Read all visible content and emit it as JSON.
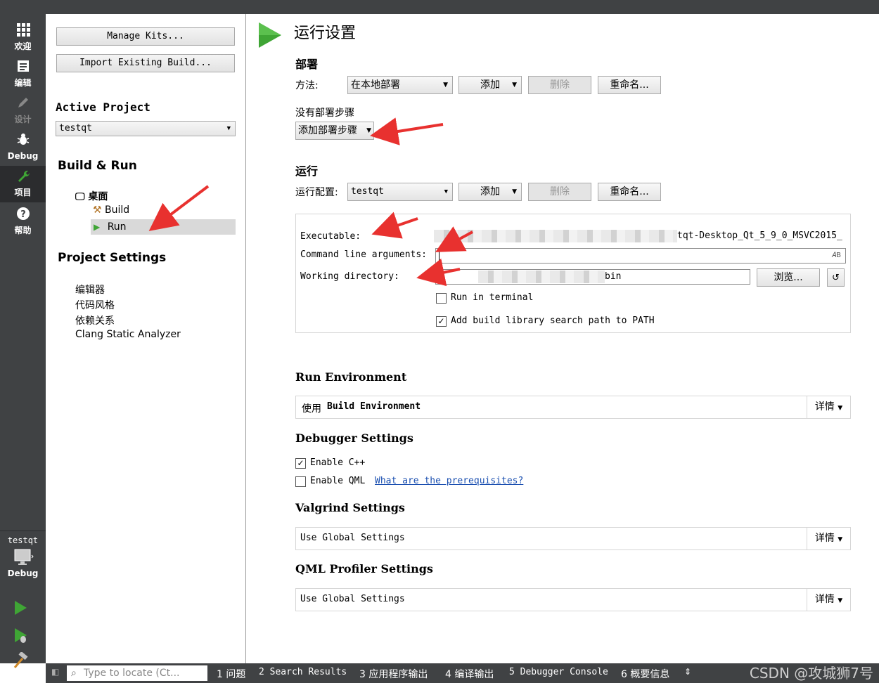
{
  "modebar": {
    "modes": [
      {
        "label": "欢迎",
        "icon": "grid-icon"
      },
      {
        "label": "编辑",
        "icon": "document-icon"
      },
      {
        "label": "设计",
        "icon": "pen-icon"
      },
      {
        "label": "Debug",
        "icon": "bug-icon"
      },
      {
        "label": "项目",
        "icon": "wrench-icon"
      },
      {
        "label": "帮助",
        "icon": "help-icon"
      }
    ],
    "kit_project": "testqt",
    "kit_mode": "Debug"
  },
  "leftpanel": {
    "manage_kits": "Manage Kits...",
    "import_build": "Import Existing Build...",
    "active_project_title": "Active Project",
    "active_project_value": "testqt",
    "build_run_title": "Build & Run",
    "kit_name": "桌面",
    "build_item": "Build",
    "run_item": "Run",
    "project_settings_title": "Project Settings",
    "settings_items": [
      "编辑器",
      "代码风格",
      "依赖关系",
      "Clang Static Analyzer"
    ]
  },
  "main": {
    "title": "运行设置",
    "deploy": {
      "title": "部署",
      "method_label": "方法:",
      "method_value": "在本地部署",
      "add": "添加",
      "remove": "删除",
      "rename": "重命名...",
      "no_steps": "没有部署步骤",
      "add_step": "添加部署步骤"
    },
    "run": {
      "title": "运行",
      "config_label": "运行配置:",
      "config_value": "testqt",
      "add": "添加",
      "remove": "删除",
      "rename": "重命名...",
      "executable_label": "Executable:",
      "executable_value": "tqt-Desktop_Qt_5_9_0_MSVC2015_",
      "args_label": "Command line arguments:",
      "workdir_label": "Working directory:",
      "workdir_value": "bin",
      "browse": "浏览...",
      "run_in_terminal": "Run in terminal",
      "run_in_terminal_checked": false,
      "add_build_lib": "Add build library search path to PATH",
      "add_build_lib_checked": true
    },
    "run_env": {
      "title": "Run Environment",
      "value_prefix": "使用",
      "value_bold": "Build Environment",
      "details": "详情"
    },
    "debugger": {
      "title": "Debugger Settings",
      "enable_cpp": "Enable C++",
      "enable_cpp_checked": true,
      "enable_qml": "Enable QML",
      "enable_qml_checked": false,
      "prereq_link": "What are the prerequisites?"
    },
    "valgrind": {
      "title": "Valgrind Settings",
      "value": "Use Global Settings",
      "details": "详情"
    },
    "qml_profiler": {
      "title": "QML Profiler Settings",
      "value": "Use Global Settings",
      "details": "详情"
    }
  },
  "statusbar": {
    "locator_placeholder": "Type to locate (Ct...",
    "items": [
      "1 问题",
      "2 Search Results",
      "3 应用程序输出",
      "4 编译输出",
      "5 Debugger Console",
      "6 概要信息"
    ],
    "watermark": "CSDN @攻城狮7号"
  },
  "colors": {
    "accent_green": "#3fa535",
    "annotation_red": "#e8312f",
    "sidebar_dark": "#404244"
  }
}
